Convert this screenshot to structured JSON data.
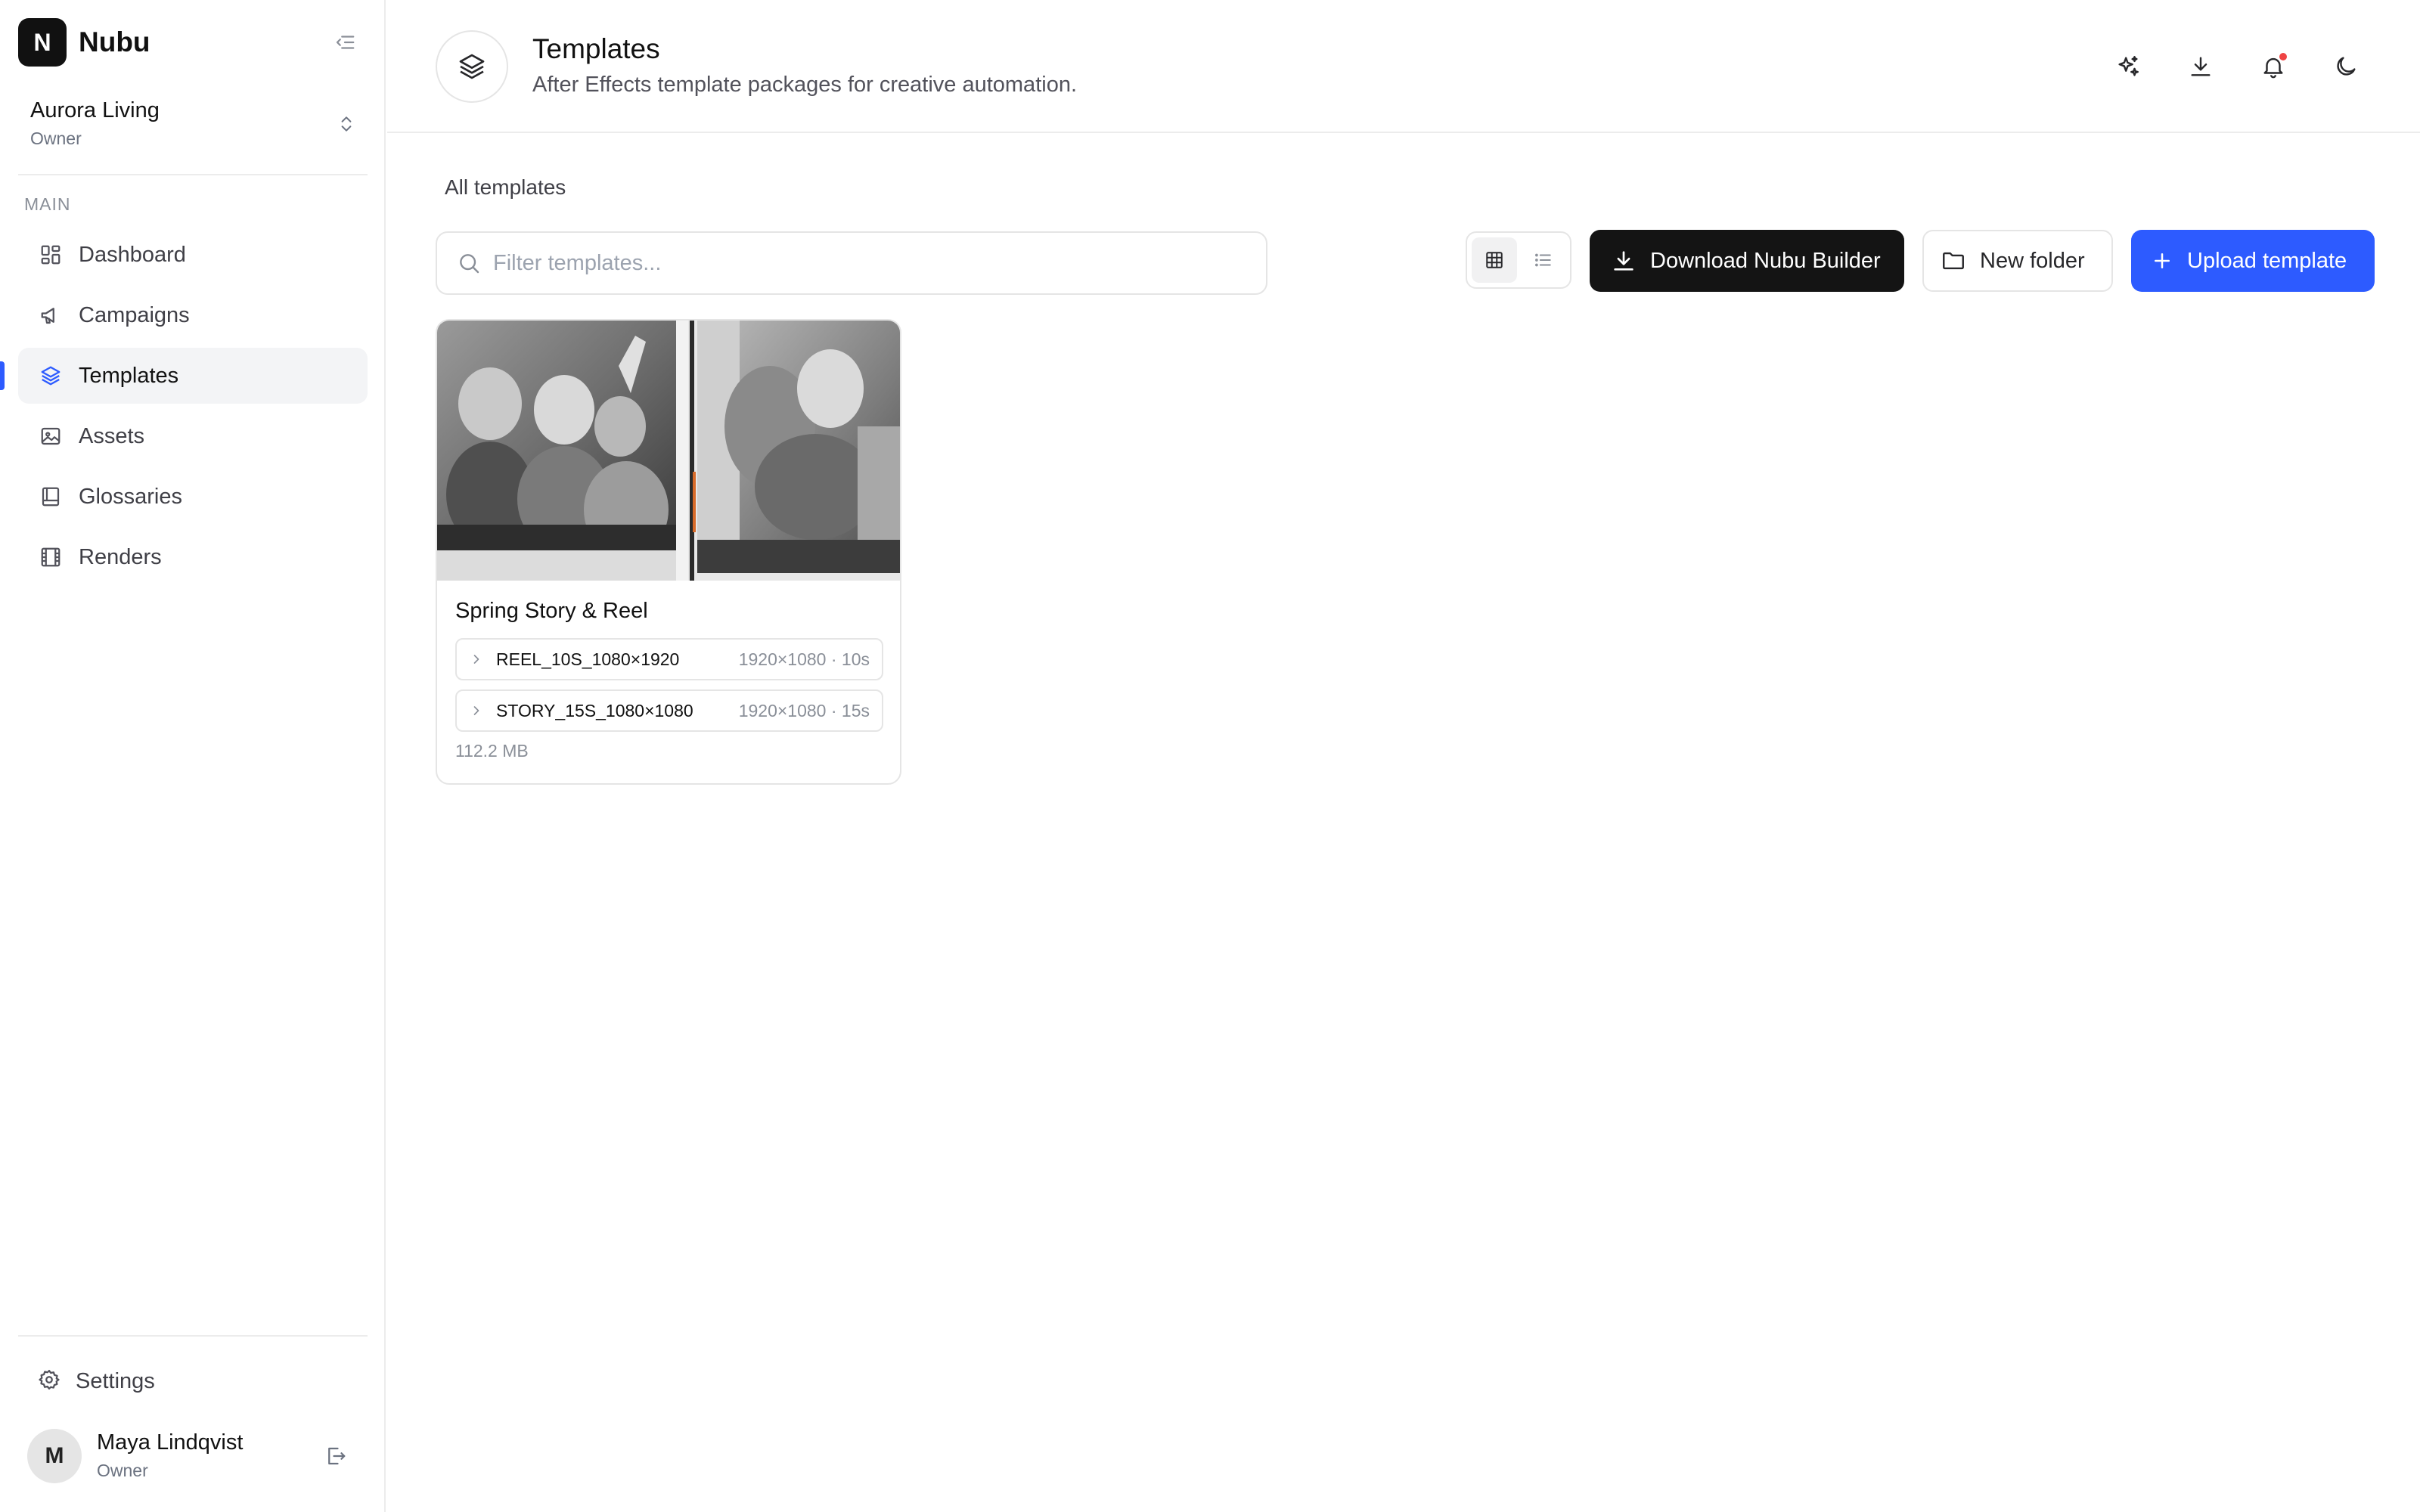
{
  "app": {
    "name": "Nubu",
    "logo_letter": "N"
  },
  "workspace": {
    "name": "Aurora Living",
    "role": "Owner"
  },
  "sidebar": {
    "section_label": "MAIN",
    "items": [
      {
        "label": "Dashboard",
        "icon": "dashboard-icon",
        "active": false
      },
      {
        "label": "Campaigns",
        "icon": "megaphone-icon",
        "active": false
      },
      {
        "label": "Templates",
        "icon": "layers-icon",
        "active": true
      },
      {
        "label": "Assets",
        "icon": "image-folder-icon",
        "active": false
      },
      {
        "label": "Glossaries",
        "icon": "book-icon",
        "active": false
      },
      {
        "label": "Renders",
        "icon": "film-icon",
        "active": false
      }
    ],
    "settings_label": "Settings"
  },
  "user": {
    "initial": "M",
    "name": "Maya Lindqvist",
    "role": "Owner"
  },
  "header": {
    "title": "Templates",
    "subtitle": "After Effects template packages for creative automation.",
    "actions": [
      "sparkles-icon",
      "download-icon",
      "bell-icon",
      "moon-icon"
    ],
    "has_notification": true
  },
  "content": {
    "breadcrumb": "All templates",
    "search_placeholder": "Filter templates...",
    "view_mode": "grid",
    "buttons": {
      "download_builder": "Download Nubu Builder",
      "new_folder": "New folder",
      "upload": "Upload template"
    }
  },
  "templates": [
    {
      "title": "Spring Story & Reel",
      "compositions": [
        {
          "name": "REEL_10S_1080×1920",
          "meta": "1920×1080 · 10s"
        },
        {
          "name": "STORY_15S_1080×1080",
          "meta": "1920×1080 · 15s"
        }
      ],
      "size": "112.2 MB"
    }
  ],
  "colors": {
    "accent": "#2d5bff",
    "dark_button": "#141414",
    "notification": "#ef4444",
    "border": "#e5e5e5"
  }
}
